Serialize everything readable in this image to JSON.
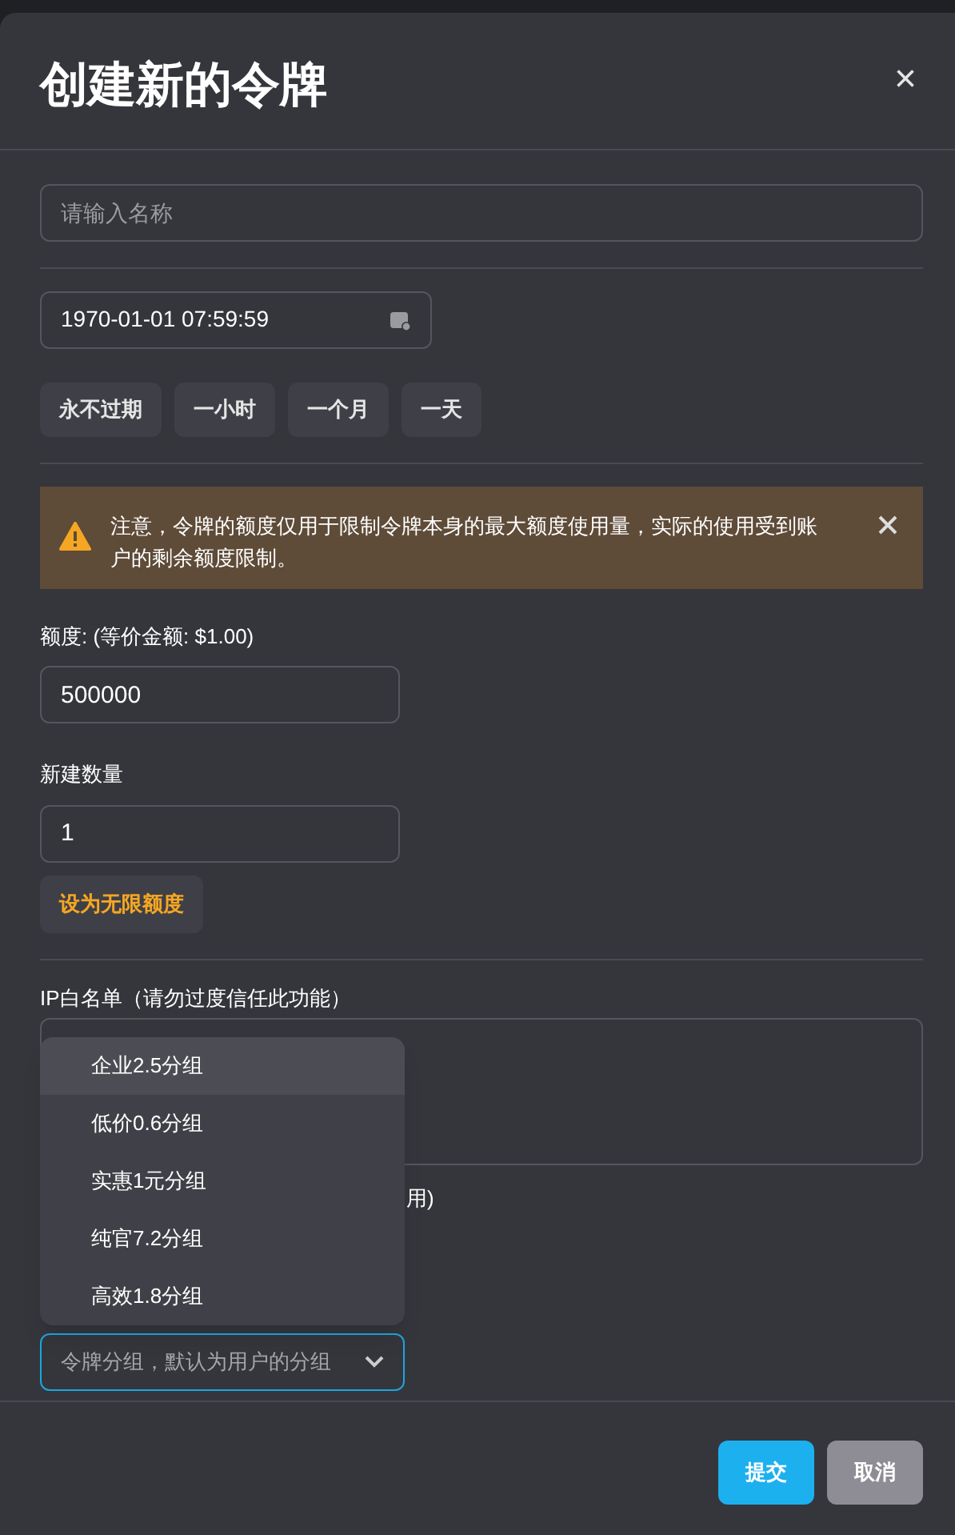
{
  "dialog": {
    "title": "创建新的令牌",
    "close": "×"
  },
  "name_field": {
    "placeholder": "请输入名称"
  },
  "expiry_field": {
    "value": "1970-01-01 07:59:59"
  },
  "expiry_presets": [
    "永不过期",
    "一小时",
    "一个月",
    "一天"
  ],
  "alert": {
    "text": "注意，令牌的额度仅用于限制令牌本身的最大额度使用量，实际的使用受到账户的剩余额度限制。"
  },
  "quota": {
    "label": "额度: (等价金额: $1.00)",
    "value": "500000"
  },
  "count": {
    "label": "新建数量",
    "value": "1"
  },
  "unlimited_button": "设为无限额度",
  "ip_whitelist": {
    "label": "IP白名单（请勿过度信任此功能）"
  },
  "partial_label": "用)",
  "group_dropdown": {
    "open": true,
    "placeholder": "令牌分组，默认为用户的分组",
    "options": [
      {
        "label": "企业2.5分组",
        "highlighted": true
      },
      {
        "label": "低价0.6分组",
        "highlighted": false
      },
      {
        "label": "实惠1元分组",
        "highlighted": false
      },
      {
        "label": "纯官7.2分组",
        "highlighted": false
      },
      {
        "label": "高效1.8分组",
        "highlighted": false
      }
    ]
  },
  "buttons": [
    {
      "label": "提交",
      "kind": "primary"
    },
    {
      "label": "取消",
      "kind": "secondary"
    }
  ]
}
